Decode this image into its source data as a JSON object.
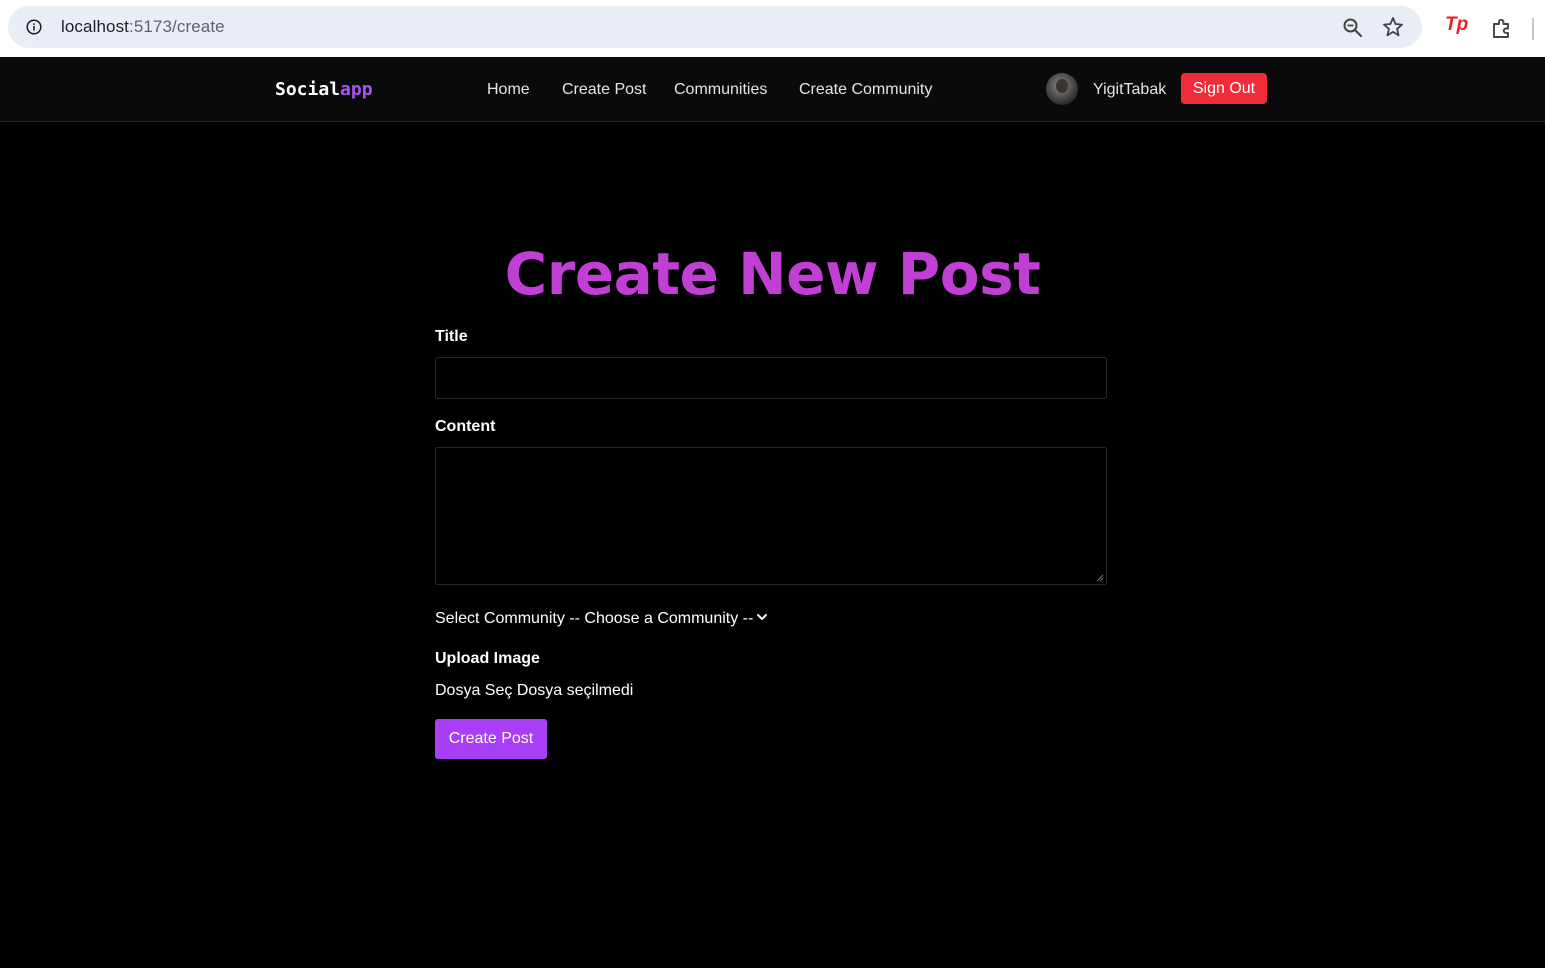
{
  "browser": {
    "url_host": "localhost",
    "url_path": ":5173/create",
    "icons": [
      "info-icon",
      "zoom-icon",
      "star-icon",
      "tp-extension-icon",
      "extensions-puzzle-icon"
    ],
    "tp_label": "Tp"
  },
  "nav": {
    "brand_main": "Social",
    "brand_accent": "app",
    "links": [
      "Home",
      "Create Post",
      "Communities",
      "Create Community"
    ],
    "username": "YigitTabak",
    "signout_label": "Sign Out"
  },
  "form": {
    "heading": "Create New Post",
    "title_label": "Title",
    "title_value": "",
    "content_label": "Content",
    "content_value": "",
    "community_label": "Select Community",
    "community_selected": "-- Choose a Community --",
    "image_label": "Upload Image",
    "file_button": "Dosya Seç",
    "file_status": "Dosya seçilmedi",
    "submit_label": "Create Post"
  },
  "colors": {
    "brand_accent": "#a855f7",
    "heading": "#c13fd4",
    "signout": "#ef2d3a",
    "submit": "#a83ef5",
    "background": "#000000"
  }
}
